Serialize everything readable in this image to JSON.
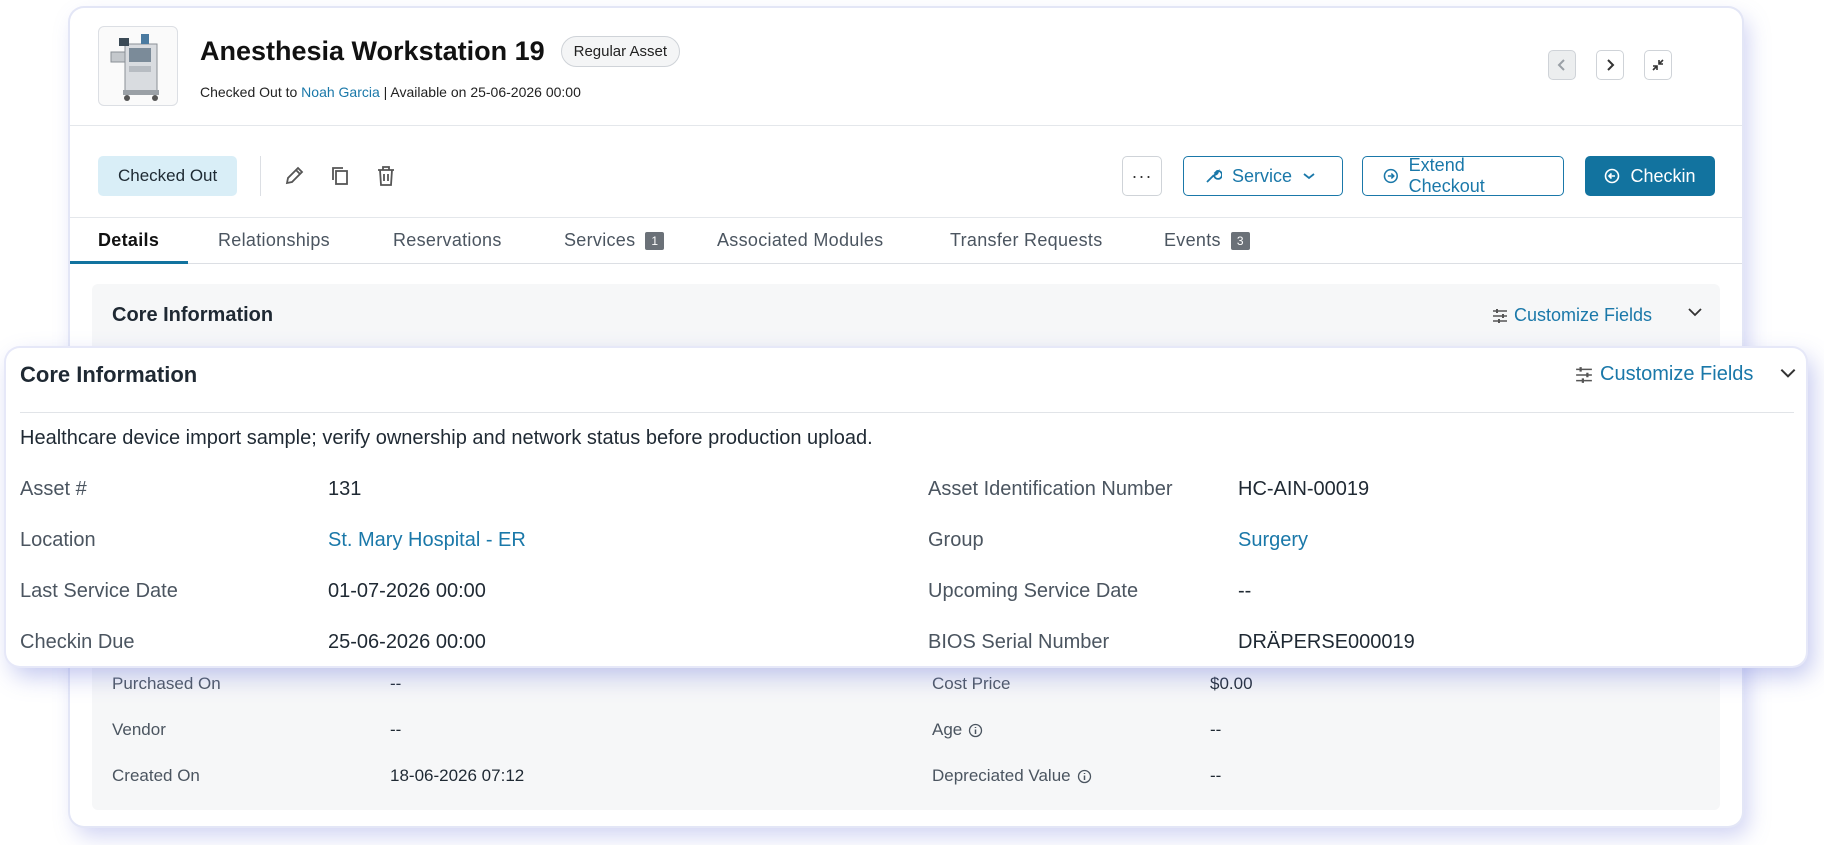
{
  "header": {
    "title": "Anesthesia Workstation 19",
    "badge": "Regular Asset",
    "checked_out_prefix": "Checked Out to",
    "checked_out_user": "Noah Garcia",
    "availability": "| Available on 25-06-2026 00:00"
  },
  "toolbar": {
    "status": "Checked Out",
    "more_label": "···",
    "service_label": "Service",
    "extend_label": "Extend Checkout",
    "checkin_label": "Checkin"
  },
  "tabs": [
    {
      "label": "Details",
      "active": true
    },
    {
      "label": "Relationships"
    },
    {
      "label": "Reservations"
    },
    {
      "label": "Services",
      "count": "1"
    },
    {
      "label": "Associated Modules"
    },
    {
      "label": "Transfer Requests"
    },
    {
      "label": "Events",
      "count": "3"
    }
  ],
  "section": {
    "title": "Core Information",
    "customize_label": "Customize Fields"
  },
  "core": {
    "note": "Healthcare device import sample; verify ownership and network status before production upload.",
    "asset_no_label": "Asset #",
    "asset_no": "131",
    "ain_label": "Asset Identification Number",
    "ain": "HC-AIN-00019",
    "location_label": "Location",
    "location": "St. Mary Hospital - ER",
    "group_label": "Group",
    "group": "Surgery",
    "last_service_label": "Last Service Date",
    "last_service": "01-07-2026 00:00",
    "upcoming_service_label": "Upcoming Service Date",
    "upcoming_service": "--",
    "checkin_due_label": "Checkin Due",
    "checkin_due": "25-06-2026 00:00",
    "bios_label": "BIOS Serial Number",
    "bios": "DRÄPERSE000019"
  },
  "more": {
    "purchased_label": "Purchased On",
    "purchased": "--",
    "cost_label": "Cost Price",
    "cost": "$0.00",
    "vendor_label": "Vendor",
    "vendor": "--",
    "age_label": "Age",
    "age": "--",
    "created_label": "Created On",
    "created": "18-06-2026 07:12",
    "depreciated_label": "Depreciated Value",
    "depreciated": "--"
  },
  "colors": {
    "accent": "#12739f",
    "link": "#1a78a9",
    "status_bg": "#d9eef7"
  }
}
